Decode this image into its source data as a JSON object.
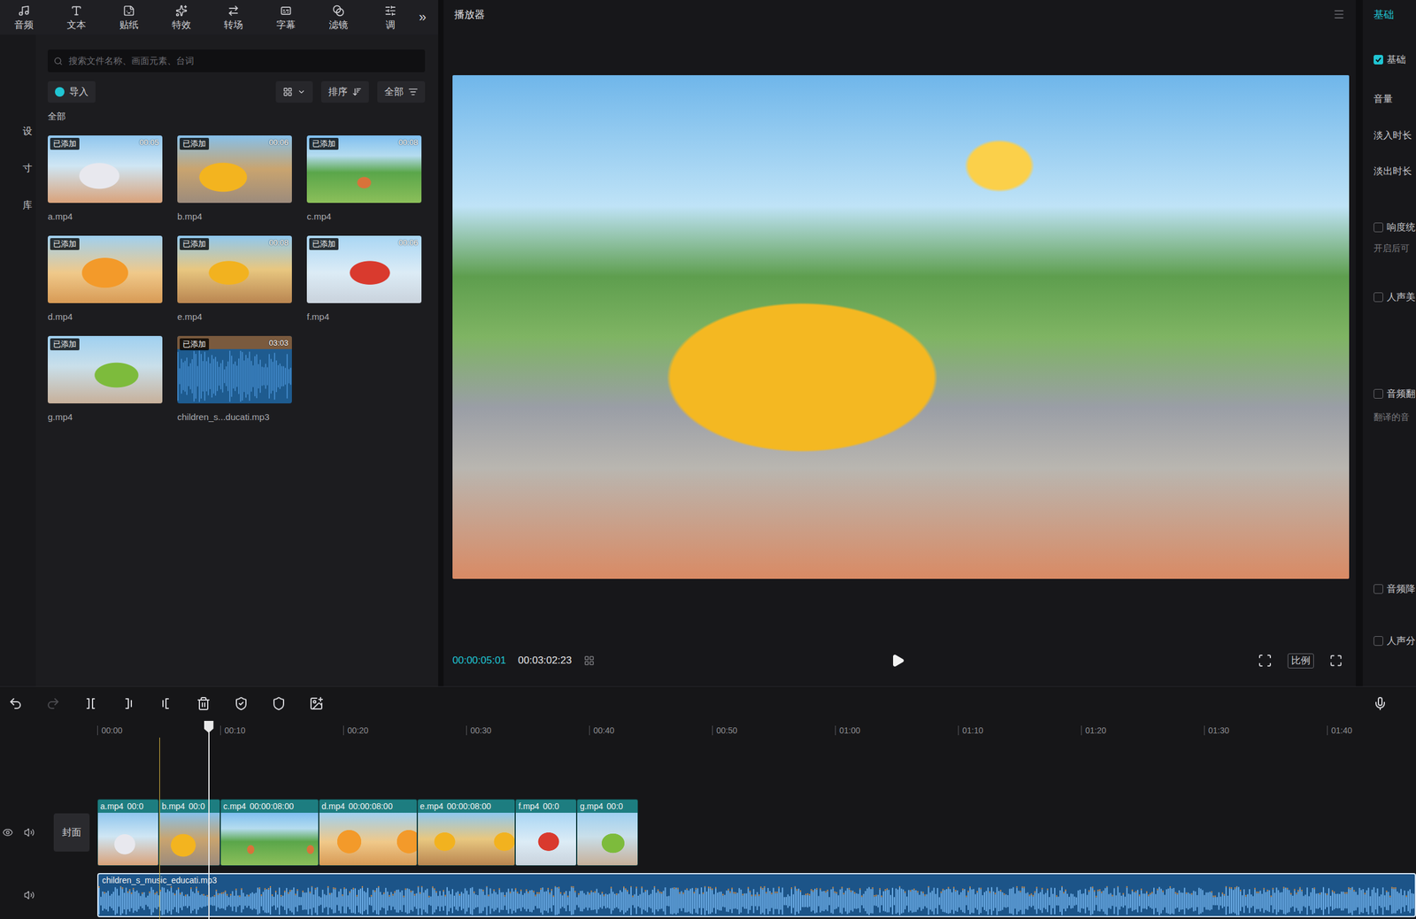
{
  "toolbar": {
    "tabs": [
      {
        "label": "音频",
        "selected": false
      },
      {
        "label": "文本",
        "selected": false
      },
      {
        "label": "贴纸",
        "selected": false
      },
      {
        "label": "特效",
        "selected": false
      },
      {
        "label": "转场",
        "selected": false
      },
      {
        "label": "字幕",
        "selected": false
      },
      {
        "label": "滤镜",
        "selected": false
      },
      {
        "label": "调",
        "selected": false
      }
    ],
    "more": "»"
  },
  "side_nav": {
    "items": [
      "设",
      "寸",
      "库"
    ]
  },
  "media": {
    "search_placeholder": "搜索文件名称、画面元素、台词",
    "import": "导入",
    "sort": "排序",
    "filter": "全部",
    "section": "全部",
    "items": [
      {
        "name": "a.mp4",
        "badge": "已添加",
        "duration": "00:05",
        "kind": "video"
      },
      {
        "name": "b.mp4",
        "badge": "已添加",
        "duration": "00:06",
        "kind": "video"
      },
      {
        "name": "c.mp4",
        "badge": "已添加",
        "duration": "00:08",
        "kind": "video"
      },
      {
        "name": "d.mp4",
        "badge": "已添加",
        "kind": "video"
      },
      {
        "name": "e.mp4",
        "badge": "已添加",
        "duration": "00:08",
        "kind": "video"
      },
      {
        "name": "f.mp4",
        "badge": "已添加",
        "duration": "00:06",
        "kind": "video"
      },
      {
        "name": "g.mp4",
        "badge": "已添加",
        "kind": "video"
      },
      {
        "name": "children_s...ducati.mp3",
        "badge": "已添加",
        "duration": "03:03",
        "kind": "audio"
      }
    ]
  },
  "player": {
    "title": "播放器",
    "current_time": "00:00:05:01",
    "total_time": "00:03:02:23",
    "ratio": "比例"
  },
  "inspector": {
    "tab": {
      "label": "基础",
      "selected": true
    },
    "items": [
      {
        "kind": "checkbox",
        "label": "基础",
        "checked": true
      },
      {
        "kind": "label",
        "label": "音量"
      },
      {
        "kind": "label",
        "label": "淡入时长"
      },
      {
        "kind": "label",
        "label": "淡出时长"
      },
      {
        "kind": "checkbox",
        "label": "响度统",
        "checked": false
      },
      {
        "kind": "note",
        "label": "开启后可"
      },
      {
        "kind": "checkbox",
        "label": "人声美",
        "checked": false
      },
      {
        "kind": "checkbox",
        "label": "音频翻",
        "checked": false
      },
      {
        "kind": "note",
        "label": "翻译的音"
      },
      {
        "kind": "checkbox",
        "label": "音频降",
        "checked": false
      },
      {
        "kind": "checkbox",
        "label": "人声分",
        "checked": false
      }
    ]
  },
  "timeline": {
    "tools": [
      {
        "kind": "undo",
        "disabled": false
      },
      {
        "kind": "redo",
        "disabled": true
      },
      {
        "kind": "split",
        "disabled": false
      },
      {
        "kind": "trim-left",
        "disabled": false
      },
      {
        "kind": "trim-right",
        "disabled": false
      },
      {
        "kind": "delete",
        "disabled": false
      },
      {
        "kind": "mark",
        "disabled": false
      },
      {
        "kind": "shield",
        "disabled": false
      },
      {
        "kind": "crop",
        "disabled": false
      }
    ],
    "ruler": [
      "00:00",
      "00:10",
      "00:20",
      "00:30",
      "00:40",
      "00:50",
      "01:00",
      "01:10",
      "01:20",
      "01:30",
      "01:40"
    ],
    "cover": "封面",
    "clips": [
      {
        "name": "a.mp4",
        "duration": "00:0"
      },
      {
        "name": "b.mp4",
        "duration": "00:0"
      },
      {
        "name": "c.mp4",
        "duration": "00:00:08:00"
      },
      {
        "name": "d.mp4",
        "duration": "00:00:08:00"
      },
      {
        "name": "e.mp4",
        "duration": "00:00:08:00"
      },
      {
        "name": "f.mp4",
        "duration": "00:0"
      },
      {
        "name": "g.mp4",
        "duration": "00:0"
      }
    ],
    "audio": {
      "name": "children_s_music_educati.mp3"
    },
    "playhead": {
      "level": 0.084
    },
    "marker": {
      "level": 0.047
    }
  }
}
